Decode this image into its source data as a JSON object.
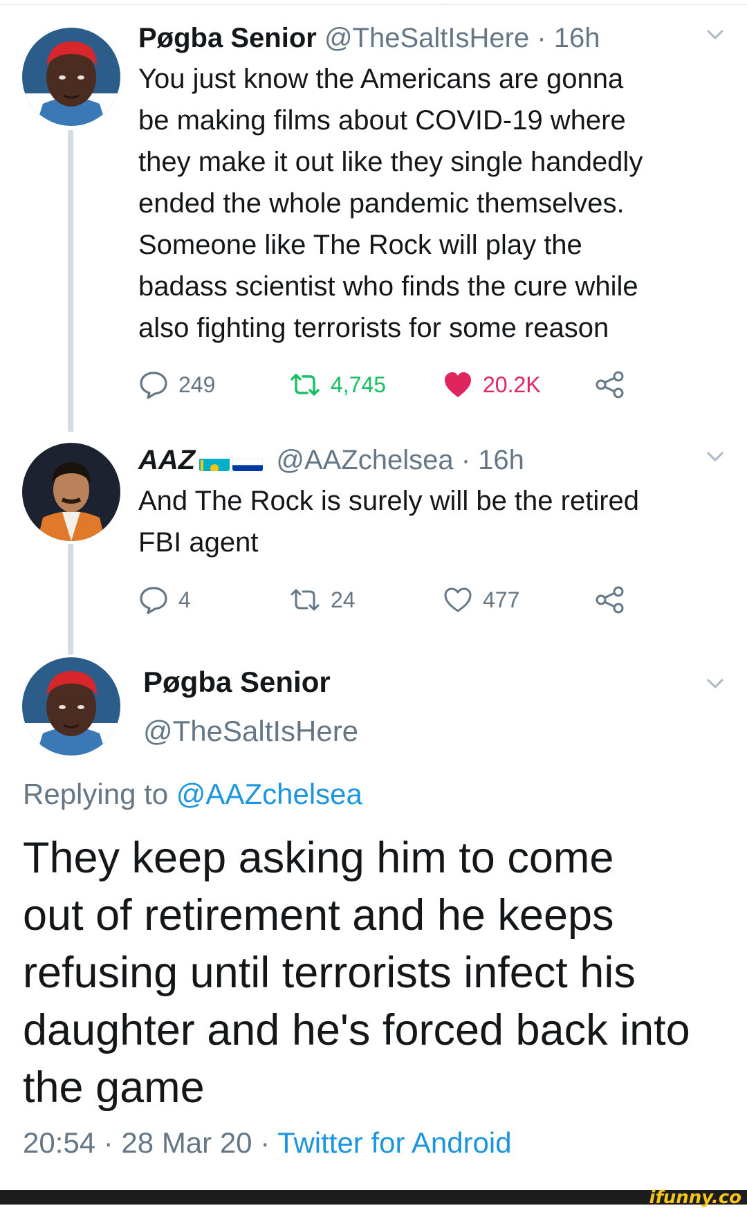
{
  "tweets": [
    {
      "name": "Pøgba Senior",
      "handle": "@TheSaltIsHere",
      "time": "· 16h",
      "text": "You just know the Americans are gonna\nbe making films about COVID-19 where\nthey make it out like they single handedly\nended the whole pandemic themselves.\nSomeone like The Rock will play the\nbadass scientist who finds the cure while\nalso fighting terrorists for some reason",
      "replies": "249",
      "retweets": "4,745",
      "likes": "20.2K"
    },
    {
      "name": "AAZ",
      "handle": "@AAZchelsea",
      "time": "· 16h",
      "text": "And The Rock is surely will be the retired\nFBI agent",
      "replies": "4",
      "retweets": "24",
      "likes": "477"
    }
  ],
  "main_tweet": {
    "name": "Pøgba Senior",
    "handle": "@TheSaltIsHere",
    "replying_prefix": "Replying to",
    "replying_handle": "@AAZchelsea",
    "text": "They keep asking him to come\nout of retirement and he keeps\nrefusing until terrorists infect his\ndaughter and he's forced back into\nthe game",
    "time": "20:54 · 28 Mar 20 ·",
    "source": "Twitter for Android"
  },
  "watermark": "ifunny.co",
  "colors": {
    "accent": "#1b95e0",
    "muted": "#657786",
    "retweet_active": "#17bf63",
    "like_active": "#e0245e",
    "thread_line": "#d3dce3"
  },
  "icons": [
    "reply-icon",
    "retweet-icon",
    "heart-icon",
    "share-icon",
    "chevron-down-icon",
    "kazakhstan-flag-icon",
    "russia-flag-icon"
  ]
}
